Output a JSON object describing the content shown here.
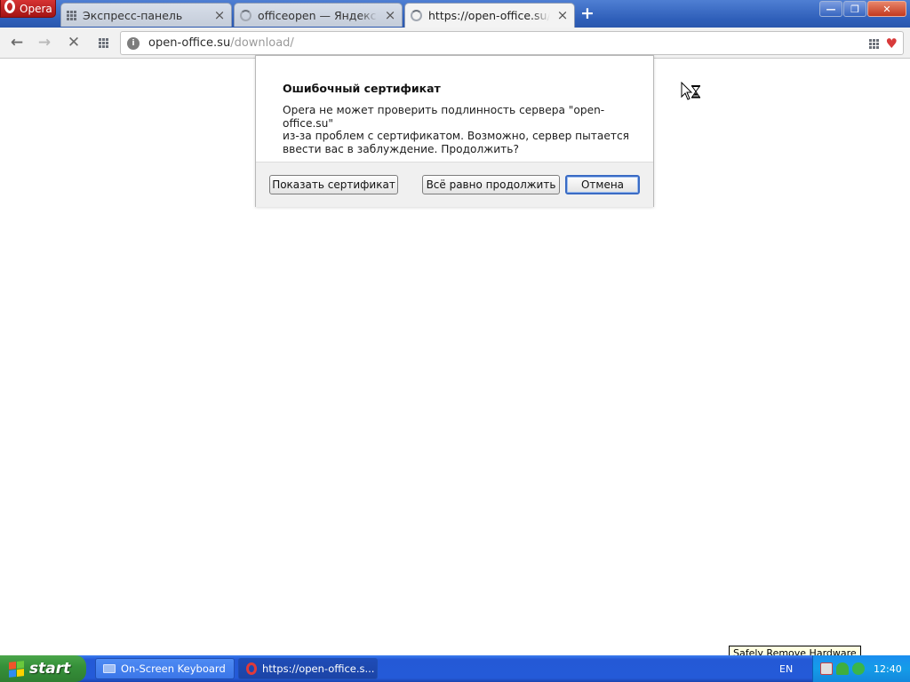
{
  "browser": {
    "app_button_label": "Opera",
    "tabs": [
      {
        "title": "Экспресс-панель",
        "close_glyph": "×",
        "icon": "speed-dial-icon"
      },
      {
        "title": "officeopen — Яндекс: на",
        "close_glyph": "×",
        "icon": "loading-spinner-icon"
      },
      {
        "title": "https://open-office.su/do",
        "close_glyph": "×",
        "icon": "loading-spinner-icon",
        "active": true
      }
    ],
    "new_tab_glyph": "+",
    "window_controls": {
      "minimize": "—",
      "maximize": "❐",
      "close": "✕"
    }
  },
  "toolbar": {
    "back_glyph": "←",
    "forward_glyph": "→",
    "stop_glyph": "✕",
    "url_host": "open-office.su",
    "url_path": "/download/"
  },
  "dialog": {
    "title": "Ошибочный сертификат",
    "message": "Opera не может проверить подлинность сервера \"open-office.su\"\nиз-за проблем с сертификатом. Возможно, сервер пытается\nввести вас в заблуждение. Продолжить?",
    "buttons": {
      "show_certificate": "Показать сертификат",
      "continue_anyway": "Всё равно продолжить",
      "cancel": "Отмена"
    }
  },
  "taskbar": {
    "start_label": "start",
    "items": [
      {
        "label": "On-Screen Keyboard",
        "icon": "keyboard-icon"
      },
      {
        "label": "https://open-office.s...",
        "icon": "opera-icon",
        "active": true
      }
    ],
    "language": "EN",
    "clock": "12:40",
    "tooltip": "Safely Remove Hardware"
  },
  "colors": {
    "titlebar": "#2f5fb9",
    "opera_red": "#c32020",
    "taskbar_blue": "#245ad8",
    "start_green": "#36913a",
    "tray_blue": "#149ce8"
  }
}
